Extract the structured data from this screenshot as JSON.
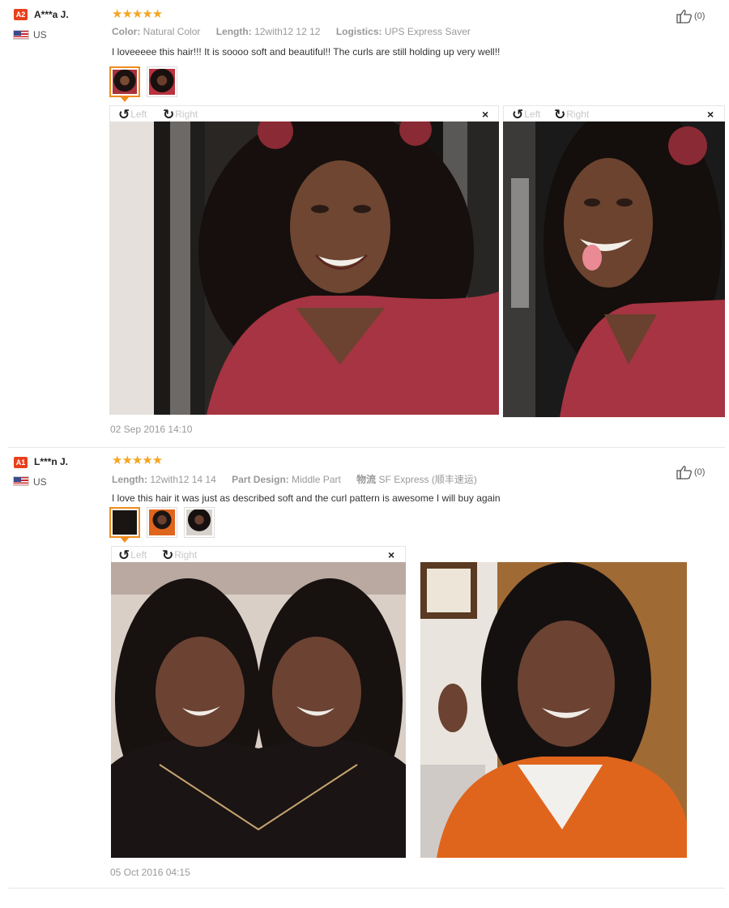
{
  "reviews": [
    {
      "badge": "A2",
      "username": "A***a J.",
      "country": "US",
      "stars": "★★★★★",
      "attributes": [
        {
          "key": "Color:",
          "value": "Natural Color"
        },
        {
          "key": "Length:",
          "value": "12with12 12 12"
        },
        {
          "key": "Logistics:",
          "value": "UPS Express Saver"
        }
      ],
      "text": "I loveeeee this hair!!! It is soooo soft and beautiful!! The curls are still holding up very well!!",
      "helpful": "(0)",
      "date": "02 Sep 2016 14:10",
      "viewer": {
        "rotate_left": "Left",
        "rotate_right": "Right",
        "close": "×"
      }
    },
    {
      "badge": "A1",
      "username": "L***n J.",
      "country": "US",
      "stars": "★★★★★",
      "attributes": [
        {
          "key": "Length:",
          "value": "12with12 14 14"
        },
        {
          "key": "Part Design:",
          "value": "Middle Part"
        },
        {
          "key": "物流",
          "value": "SF Express (顺丰速运)"
        }
      ],
      "text": "I love this hair it was just as described soft and the curl pattern is awesome I will buy again",
      "helpful": "(0)",
      "date": "05 Oct 2016 04:15",
      "viewer": {
        "rotate_left": "Left",
        "rotate_right": "Right",
        "close": "×"
      }
    }
  ],
  "colors": {
    "accent": "#f08c1e",
    "star": "#f5a623",
    "badge": "#e8401c"
  },
  "icons": {
    "helpful": "thumbs-up-icon",
    "rotate_left": "rotate-left-icon",
    "rotate_right": "rotate-right-icon",
    "close": "close-icon",
    "flag": "us-flag-icon"
  }
}
